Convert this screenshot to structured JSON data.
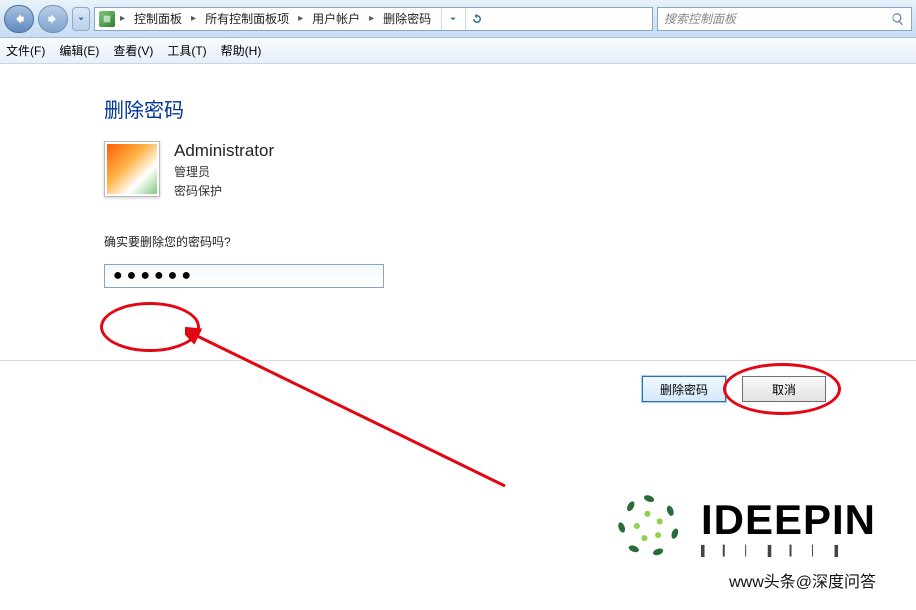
{
  "titlebar": {
    "breadcrumbs": [
      "控制面板",
      "所有控制面板项",
      "用户帐户",
      "删除密码"
    ],
    "search_placeholder": "搜索控制面板"
  },
  "menubar": {
    "file": "文件(F)",
    "edit": "编辑(E)",
    "view": "查看(V)",
    "tools": "工具(T)",
    "help": "帮助(H)"
  },
  "page": {
    "title": "删除密码",
    "user_name": "Administrator",
    "user_role": "管理员",
    "user_status": "密码保护",
    "prompt": "确实要删除您的密码吗?",
    "password_value": "●●●●●●"
  },
  "buttons": {
    "delete": "删除密码",
    "cancel": "取消"
  },
  "branding": {
    "logo_text": "IDEEPIN",
    "credit": "www头条@深度问答"
  }
}
